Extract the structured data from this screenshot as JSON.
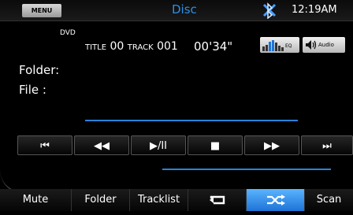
{
  "header": {
    "menu_label": "MENU",
    "source": "Disc",
    "time": "12:19AM",
    "bluetooth_icon": "bluetooth-icon",
    "source_color": "#2e8fe6"
  },
  "info": {
    "media": "DVD",
    "title_label": "TITLE",
    "title_number": "00",
    "track_label": "TRACK",
    "track_number": "001",
    "elapsed": "00'34\"",
    "eq_label": "EQ",
    "audio_label": "Audio"
  },
  "labels": {
    "folder": "Folder:",
    "file": "File   :"
  },
  "transport": [
    "⏮",
    "◀◀",
    "▶/II",
    "■",
    "▶▶",
    "⏭"
  ],
  "bottom": {
    "mute": "Mute",
    "folder": "Folder",
    "tracklist": "Tracklist",
    "repeat_icon": "repeat-icon",
    "shuffle_icon": "shuffle-icon",
    "scan": "Scan"
  },
  "accent": "#2a82d8"
}
